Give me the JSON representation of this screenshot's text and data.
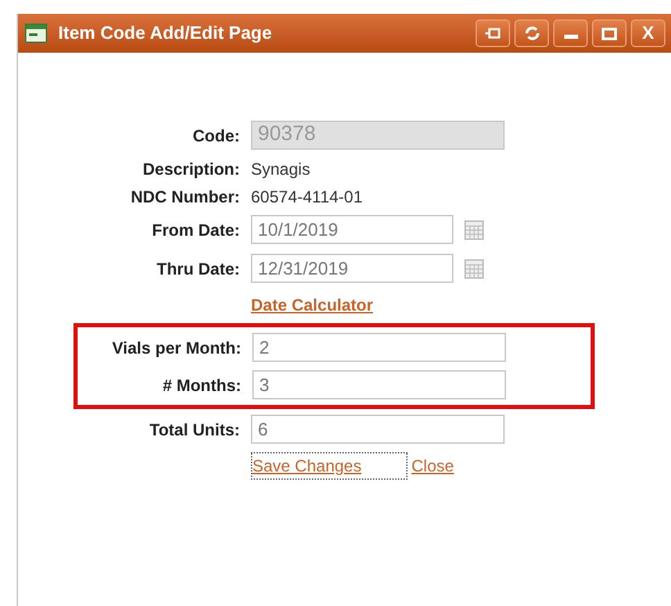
{
  "window": {
    "title": "Item Code Add/Edit Page",
    "close_glyph": "X"
  },
  "fields": [
    {
      "kind": "input",
      "label": "Code:",
      "value": "90378",
      "disabled": true,
      "highlighted": false
    },
    {
      "kind": "text",
      "label": "Description:",
      "value": "Synagis",
      "highlighted": false
    },
    {
      "kind": "text",
      "label": "NDC Number:",
      "value": "60574-4114-01",
      "highlighted": false
    },
    {
      "kind": "date",
      "label": "From Date:",
      "value": "10/1/2019",
      "disabled": false,
      "highlighted": false
    },
    {
      "kind": "date",
      "label": "Thru Date:",
      "value": "12/31/2019",
      "disabled": false,
      "highlighted": false
    },
    {
      "kind": "link",
      "label": "Date Calculator",
      "highlighted": false
    },
    {
      "kind": "input",
      "label": "Vials per Month:",
      "value": "2",
      "disabled": false,
      "highlighted": true
    },
    {
      "kind": "input",
      "label": "# Months:",
      "value": "3",
      "disabled": false,
      "highlighted": true
    },
    {
      "kind": "input",
      "label": "Total Units:",
      "value": "6",
      "disabled": false,
      "highlighted": false
    }
  ],
  "actions": [
    {
      "label": "Save Changes",
      "focused": true
    },
    {
      "label": "Close",
      "focused": false
    }
  ]
}
